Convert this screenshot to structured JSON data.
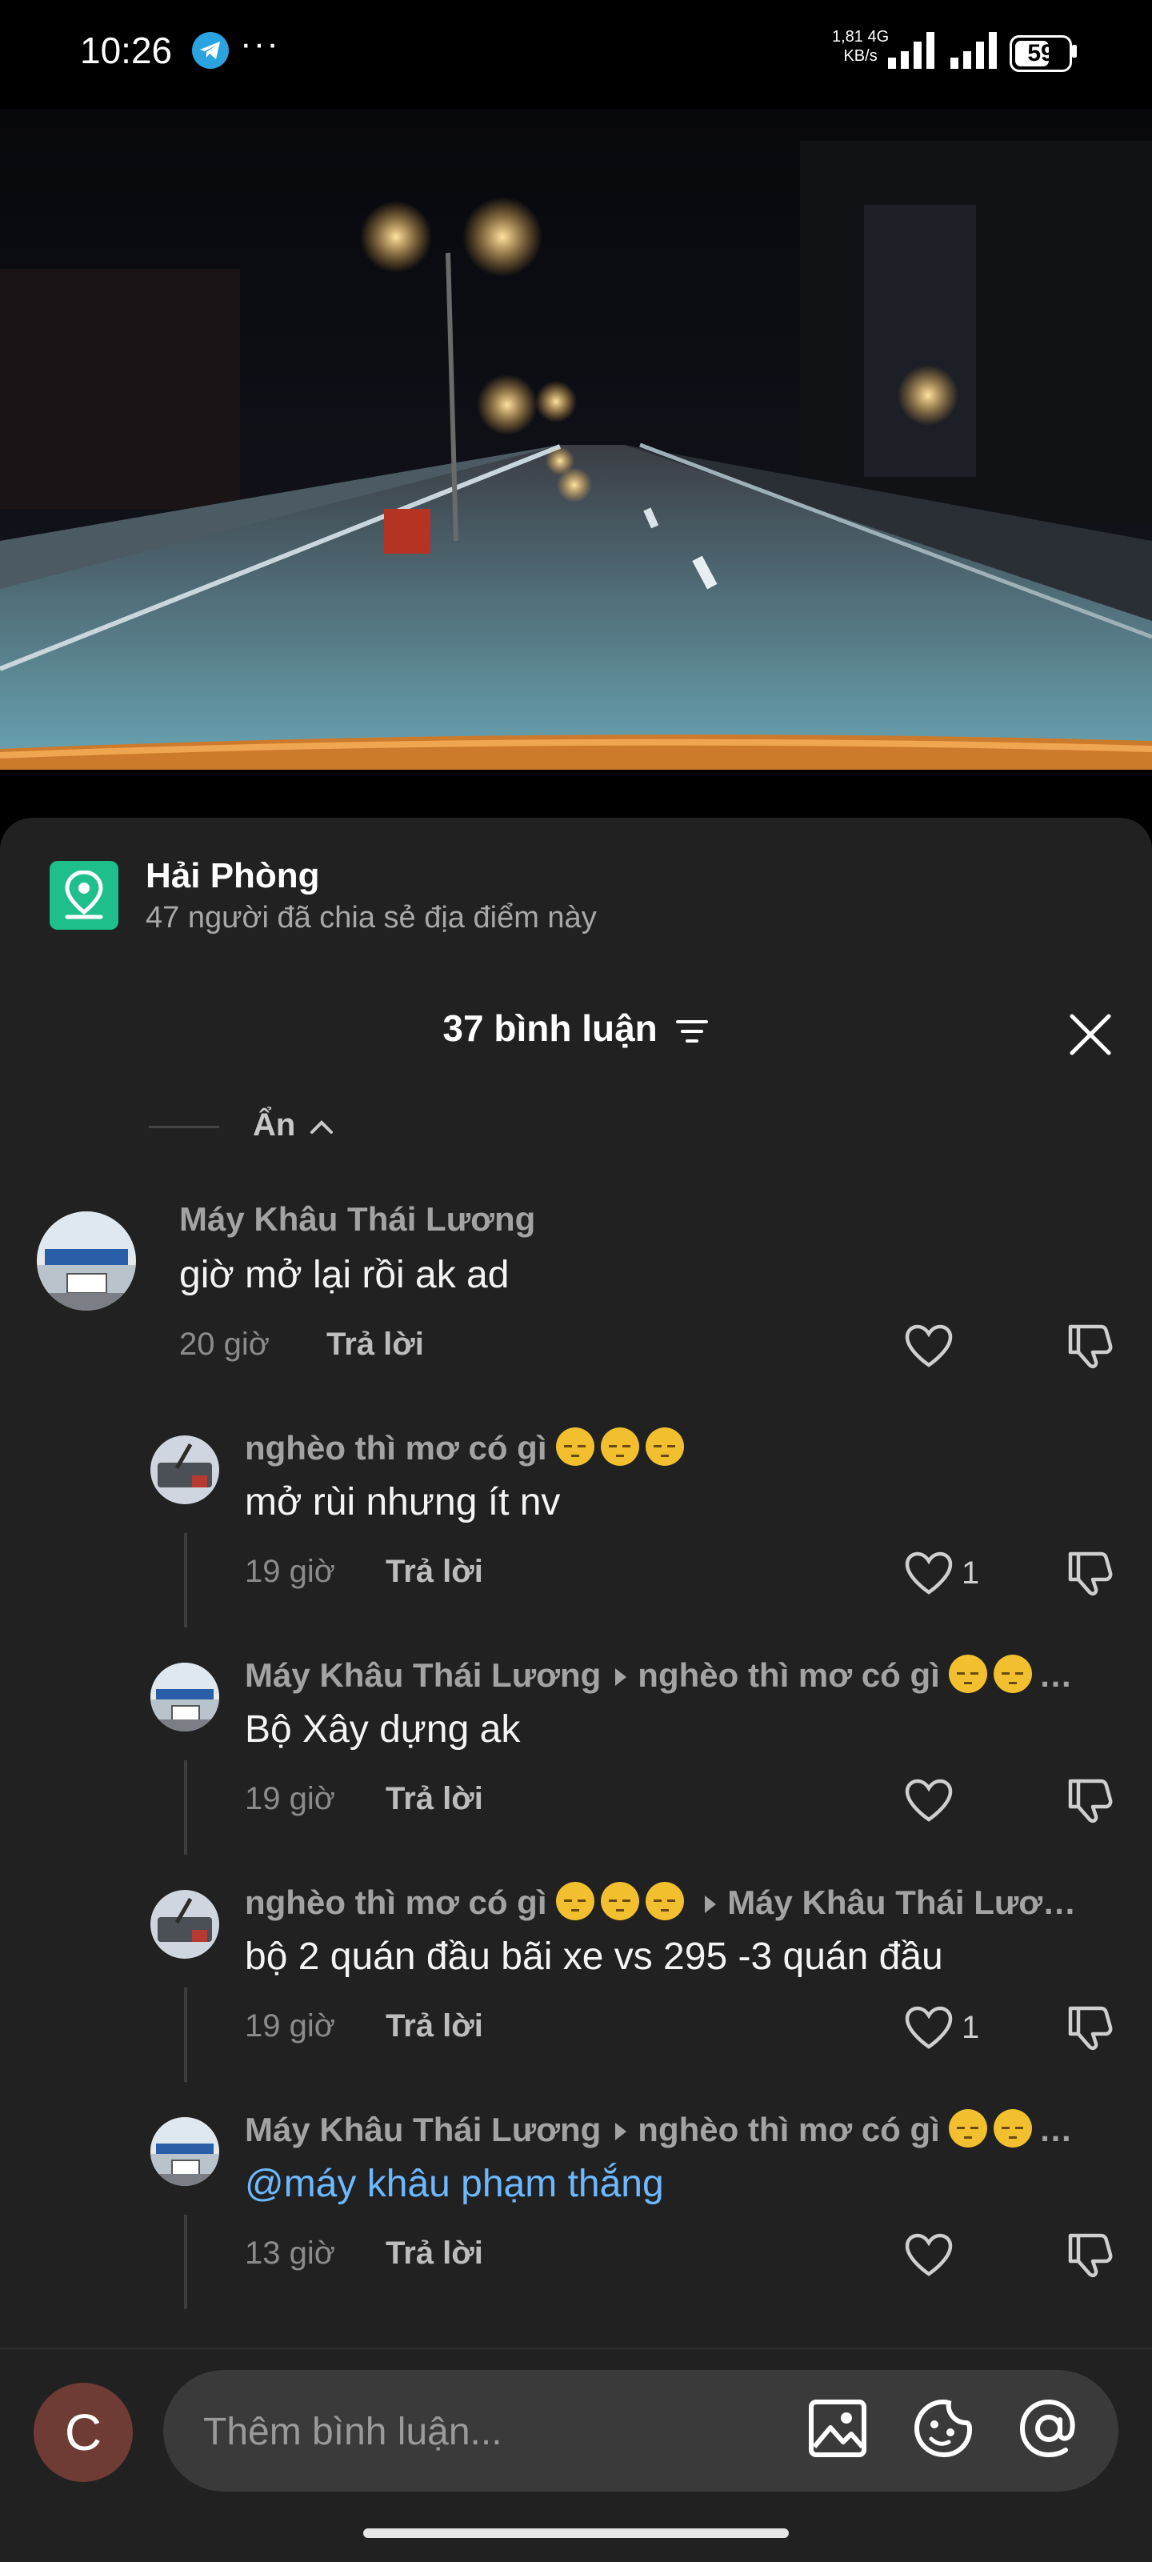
{
  "status_bar": {
    "time": "10:26",
    "speed_value": "1,81",
    "speed_unit": "KB/s",
    "network": "4G",
    "battery": "59"
  },
  "location": {
    "title": "Hải Phòng",
    "subtitle": "47 người đã chia sẻ địa điểm này"
  },
  "comments_header": {
    "title": "37 bình luận"
  },
  "hide_toggle": {
    "label": "Ẩn"
  },
  "comments": [
    {
      "author": "Máy Khâu Thái Lương",
      "text": "giờ mở lại rồi ak ad",
      "time": "20 giờ",
      "reply_label": "Trả lời",
      "likes": ""
    },
    {
      "author": "nghèo thì mơ có gì",
      "author_emoji_count": 3,
      "text": "mở rùi nhưng ít nv",
      "time": "19 giờ",
      "reply_label": "Trả lời",
      "likes": "1"
    },
    {
      "author": "Máy Khâu Thái Lương",
      "reply_to": "nghèo thì mơ có gì",
      "reply_to_suffix": "…",
      "text": "Bộ Xây dựng ak",
      "time": "19 giờ",
      "reply_label": "Trả lời",
      "likes": ""
    },
    {
      "author": "nghèo thì mơ có gì",
      "author_emoji_count": 3,
      "reply_to": "Máy Khâu Thái Lươ…",
      "text": "bộ 2 quán đầu bãi xe vs 295 -3 quán đầu",
      "time": "19 giờ",
      "reply_label": "Trả lời",
      "likes": "1"
    },
    {
      "author": "Máy Khâu Thái Lương",
      "reply_to": "nghèo thì mơ có gì",
      "reply_to_suffix": "…",
      "text": "@máy khâu phạm thắng",
      "time": "13 giờ",
      "reply_label": "Trả lời",
      "likes": ""
    }
  ],
  "composer": {
    "avatar_letter": "C",
    "placeholder": "Thêm bình luận..."
  }
}
